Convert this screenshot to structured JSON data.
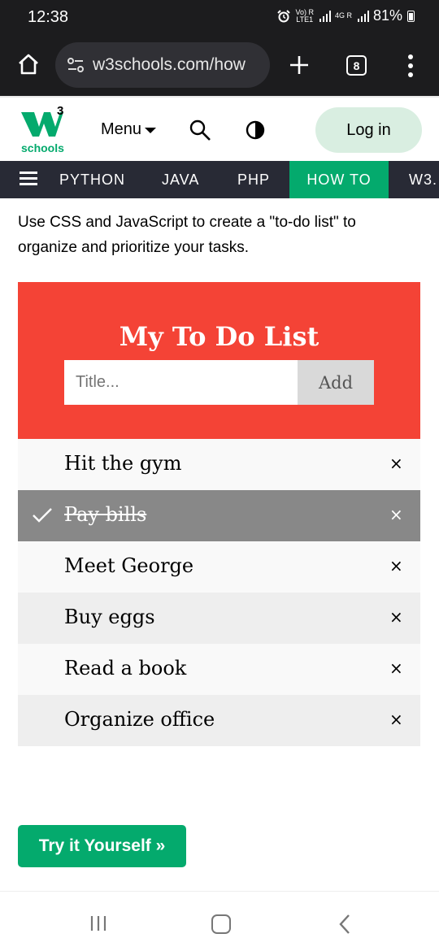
{
  "status_bar": {
    "time": "12:38",
    "network_line1": "Vo) R",
    "network_line2": "LTE1",
    "network_4g": "4G R",
    "battery": "81%"
  },
  "browser": {
    "url": "w3schools.com/how",
    "tab_count": "8",
    "icons": [
      "home-icon",
      "tune-icon",
      "plus-icon",
      "tabs-icon",
      "more-icon"
    ]
  },
  "header": {
    "logo_text": "schools",
    "logo_superscript": "3",
    "menu_label": "Menu",
    "login_label": "Log in"
  },
  "topnav": {
    "items": [
      "PYTHON",
      "JAVA",
      "PHP",
      "HOW TO",
      "W3."
    ],
    "active": "HOW TO"
  },
  "intro": "Use CSS and JavaScript to create a \"to-do list\" to organize and prioritize your tasks.",
  "todo": {
    "title": "My To Do List",
    "input_placeholder": "Title...",
    "add_label": "Add",
    "close_symbol": "×",
    "items": [
      {
        "text": "Hit the gym",
        "checked": false
      },
      {
        "text": "Pay bills",
        "checked": true
      },
      {
        "text": "Meet George",
        "checked": false
      },
      {
        "text": "Buy eggs",
        "checked": false
      },
      {
        "text": "Read a book",
        "checked": false
      },
      {
        "text": "Organize office",
        "checked": false
      }
    ]
  },
  "try_button": "Try it Yourself »",
  "colors": {
    "todo_header": "#f44336",
    "w3_green": "#04aa6d",
    "topnav_bg": "#282a35",
    "checked_item": "#888888"
  }
}
